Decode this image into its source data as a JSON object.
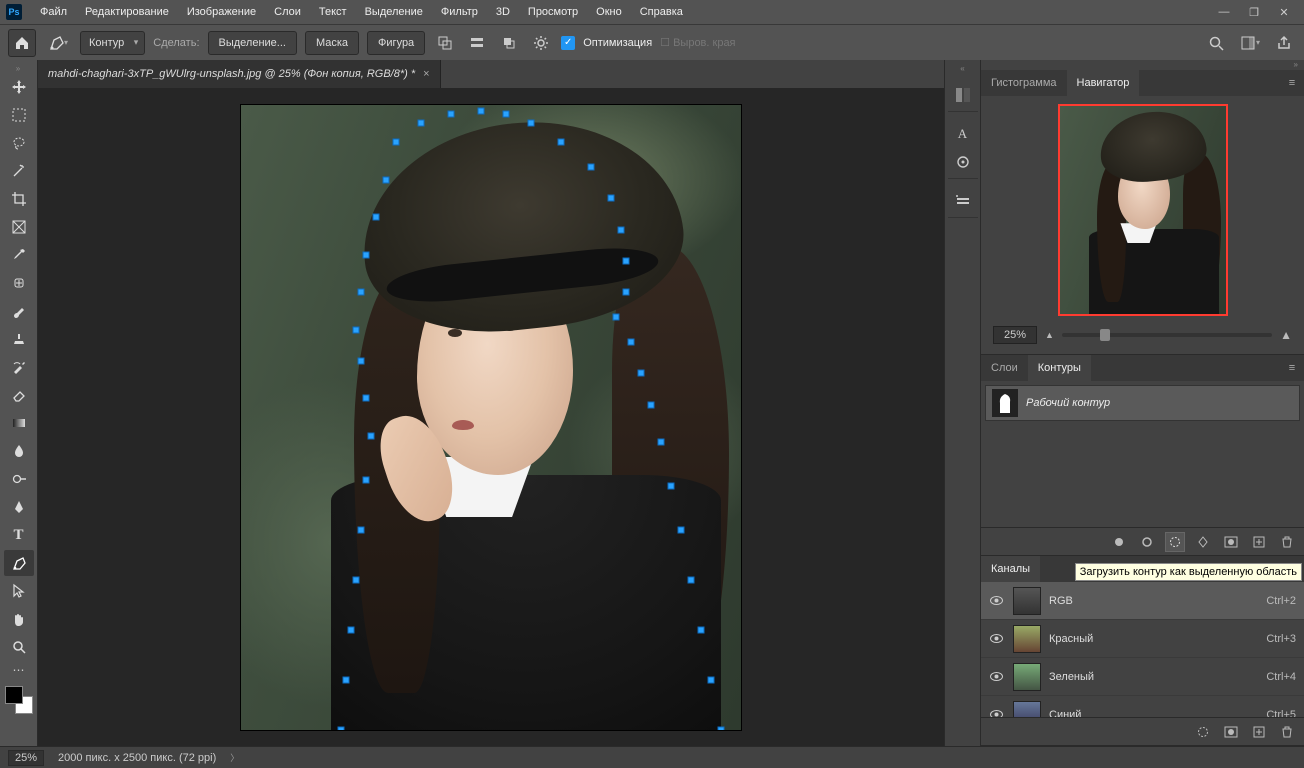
{
  "menu": {
    "items": [
      "Файл",
      "Редактирование",
      "Изображение",
      "Слои",
      "Текст",
      "Выделение",
      "Фильтр",
      "3D",
      "Просмотр",
      "Окно",
      "Справка"
    ]
  },
  "options": {
    "mode_label": "Контур",
    "make_label": "Сделать:",
    "btn_selection": "Выделение...",
    "btn_mask": "Маска",
    "btn_shape": "Фигура",
    "optim_label": "Оптимизация",
    "align_edges": "Выров. края"
  },
  "doc": {
    "tab_title": "mahdi-chaghari-3xTP_gWUlrg-unsplash.jpg @ 25% (Фон копия, RGB/8*) *"
  },
  "navigator": {
    "tab_hist": "Гистограмма",
    "tab_nav": "Навигатор",
    "zoom": "25%"
  },
  "paths": {
    "tab_layers": "Слои",
    "tab_paths": "Контуры",
    "item_name": "Рабочий контур",
    "tooltip": "Загрузить контур как выделенную область"
  },
  "channels": {
    "tab": "Каналы",
    "rows": [
      {
        "name": "RGB",
        "key": "Ctrl+2",
        "sel": true
      },
      {
        "name": "Красный",
        "key": "Ctrl+3",
        "sel": false
      },
      {
        "name": "Зеленый",
        "key": "Ctrl+4",
        "sel": false
      },
      {
        "name": "Синий",
        "key": "Ctrl+5",
        "sel": false
      }
    ]
  },
  "status": {
    "zoom": "25%",
    "info": "2000 пикс. x 2500 пикс. (72 ppi)"
  }
}
